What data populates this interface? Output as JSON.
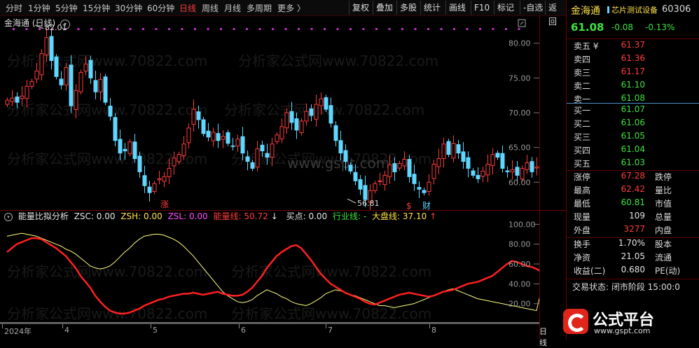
{
  "toolbar": {
    "timeframes": [
      {
        "label": "分时",
        "active": false
      },
      {
        "label": "1分钟",
        "active": false
      },
      {
        "label": "5分钟",
        "active": false
      },
      {
        "label": "15分钟",
        "active": false
      },
      {
        "label": "30分钟",
        "active": false
      },
      {
        "label": "60分钟",
        "active": false
      },
      {
        "label": "日线",
        "active": true
      },
      {
        "label": "周线",
        "active": false
      },
      {
        "label": "月线",
        "active": false
      },
      {
        "label": "多周期",
        "active": false
      },
      {
        "label": "更多 〉",
        "active": false
      }
    ],
    "tools": [
      "复权",
      "叠加",
      "多股",
      "统计",
      "画线",
      "F10",
      "标记",
      "-自选",
      "返回"
    ]
  },
  "main": {
    "title": "金海通 (日线)",
    "high_label": "82.01",
    "low_label": "56.81",
    "y_ticks": [
      "80.00",
      "75.00",
      "70.00",
      "65.00",
      "60.00"
    ],
    "watermark_site": "www.gspt.com",
    "watermark_text": "分析家公式网www.70822.com",
    "mark_zhang": "涨",
    "mark_dollar": "$",
    "mark_cai": "财"
  },
  "indicator": {
    "name": "能量比拟分析",
    "zsc": "ZSC: 0.00",
    "zsh": "ZSH: 0.00",
    "zsl": "ZSL: 0.00",
    "energy": "能量线: 50.72",
    "energy_arrow": "↓",
    "buy": "买点: 0.00",
    "industry": "行业线: -",
    "market": "大盘线: 37.10",
    "market_arrow": "↑",
    "y_ticks": [
      "100.00",
      "80.00",
      "60.00",
      "40.00",
      "20.00"
    ]
  },
  "date_axis": {
    "labels": [
      "2024年",
      "4",
      "5",
      "6",
      "7",
      "8"
    ],
    "right_label": "日线"
  },
  "panel": {
    "stock_name": "金海通",
    "sector": "芯片测试设备",
    "code": "60306",
    "price": "61.08",
    "change": "-0.08",
    "change_pct": "-0.13%",
    "asks": [
      {
        "label": "卖五 ¥",
        "price": "61.37",
        "cls": "red"
      },
      {
        "label": "卖四",
        "price": "61.36",
        "cls": "red"
      },
      {
        "label": "卖三",
        "price": "61.17",
        "cls": "red"
      },
      {
        "label": "卖二",
        "price": "61.10",
        "cls": "green"
      },
      {
        "label": "卖一",
        "price": "61.08",
        "cls": "green"
      }
    ],
    "bids": [
      {
        "label": "买一",
        "price": "61.07",
        "cls": "green"
      },
      {
        "label": "买二",
        "price": "61.06",
        "cls": "green"
      },
      {
        "label": "买三",
        "price": "61.05",
        "cls": "green"
      },
      {
        "label": "买四",
        "price": "61.04",
        "cls": "green"
      },
      {
        "label": "买五",
        "price": "61.03",
        "cls": "green"
      }
    ],
    "stats": [
      {
        "label": "涨停",
        "value": "67.28",
        "cls": "red",
        "label2": "跌停"
      },
      {
        "label": "最高",
        "value": "62.42",
        "cls": "red",
        "label2": "量比"
      },
      {
        "label": "最低",
        "value": "60.81",
        "cls": "green",
        "label2": "市值"
      },
      {
        "label": "现量",
        "value": "109",
        "cls": "white",
        "label2": "总量"
      },
      {
        "label": "外盘",
        "value": "3277",
        "cls": "red",
        "label2": "内盘"
      }
    ],
    "stats2": [
      {
        "label": "换手",
        "value": "1.70%",
        "cls": "white",
        "label2": "股本"
      },
      {
        "label": "净资",
        "value": "21.05",
        "cls": "white",
        "label2": "流通"
      },
      {
        "label": "收益(二)",
        "value": "0.680",
        "cls": "white",
        "label2": "PE(动)"
      }
    ],
    "status": "交易状态: 闭市阶段 15:00:0",
    "logo_text": "公式平台",
    "logo_url": "www.gspt.com"
  },
  "chart_data": {
    "type": "candlestick",
    "ylim": [
      56,
      84
    ],
    "closes": [
      71.8,
      72.1,
      71.5,
      72.4,
      73.8,
      74.5,
      76.0,
      78.5,
      80.8,
      77.5,
      75.2,
      74.0,
      76.5,
      71.0,
      73.2,
      75.8,
      77.0,
      75.0,
      73.0,
      74.8,
      71.5,
      69.5,
      66.0,
      64.2,
      64.5,
      65.8,
      63.4,
      61.5,
      59.5,
      58.5,
      59.8,
      60.5,
      60.8,
      62.0,
      63.5,
      64.0,
      65.5,
      67.8,
      70.5,
      69.0,
      67.0,
      66.5,
      67.2,
      66.0,
      66.6,
      65.6,
      65.2,
      66.2,
      64.2,
      63.0,
      62.0,
      64.8,
      64.5,
      63.6,
      65.5,
      66.8,
      68.0,
      70.0,
      68.6,
      67.5,
      68.8,
      70.2,
      69.6,
      71.2,
      72.0,
      70.5,
      68.5,
      66.0,
      64.2,
      63.0,
      61.6,
      60.2,
      59.0,
      57.5,
      58.8,
      59.8,
      60.2,
      61.0,
      62.5,
      61.5,
      62.7,
      63.3,
      60.8,
      59.8,
      59.0,
      58.5,
      60.0,
      62.6,
      63.4,
      65.5,
      64.0,
      65.6,
      64.2,
      63.0,
      62.0,
      61.0,
      60.5,
      61.6,
      62.6,
      64.0,
      63.6,
      62.0,
      61.5,
      61.8,
      61.0,
      62.0,
      62.8,
      61.5,
      62.2,
      61.08
    ],
    "energy_line": [
      72,
      76,
      80,
      82,
      84,
      86,
      86,
      85,
      82,
      79,
      76,
      72,
      68,
      62,
      56,
      48,
      42,
      36,
      28,
      22,
      17,
      13,
      11,
      10,
      10,
      11,
      13,
      15,
      18,
      20,
      22,
      24,
      25,
      27,
      28,
      29,
      30,
      30,
      31,
      30,
      29,
      30,
      31,
      32,
      30,
      29,
      28,
      28,
      29,
      32,
      36,
      42,
      48,
      56,
      62,
      68,
      72,
      75,
      78,
      79,
      76,
      70,
      64,
      57,
      50,
      45,
      40,
      37,
      34,
      31,
      29,
      27,
      25,
      22,
      20,
      19,
      21,
      23,
      25,
      27,
      29,
      30,
      31,
      30,
      29,
      28,
      27,
      28,
      30,
      32,
      33,
      34,
      36,
      38,
      40,
      41,
      42,
      44,
      46,
      48,
      52,
      56,
      60,
      63,
      62,
      60,
      58,
      57,
      55,
      52,
      50.72
    ],
    "market_line": [
      88,
      89,
      90,
      91,
      90,
      89,
      88,
      86,
      84,
      82,
      80,
      78,
      75,
      73,
      70,
      66,
      62,
      58,
      56,
      55,
      56,
      58,
      62,
      67,
      72,
      76,
      81,
      85,
      88,
      89,
      90,
      90,
      89,
      87,
      85,
      82,
      78,
      73,
      68,
      62,
      56,
      50,
      44,
      38,
      32,
      28,
      25,
      22,
      21,
      22,
      24,
      28,
      31,
      34,
      32,
      30,
      27,
      25,
      22,
      20,
      19,
      18,
      20,
      23,
      26,
      30,
      32,
      34,
      33,
      31,
      29,
      28,
      26,
      24,
      22,
      20,
      18,
      18,
      17,
      16,
      17,
      18,
      19,
      20,
      22,
      24,
      26,
      28,
      30,
      32,
      34,
      35,
      33,
      31,
      29,
      27,
      25,
      24,
      23,
      22,
      21,
      20,
      19,
      18,
      17,
      16,
      15,
      14,
      13,
      34,
      37.1
    ]
  }
}
